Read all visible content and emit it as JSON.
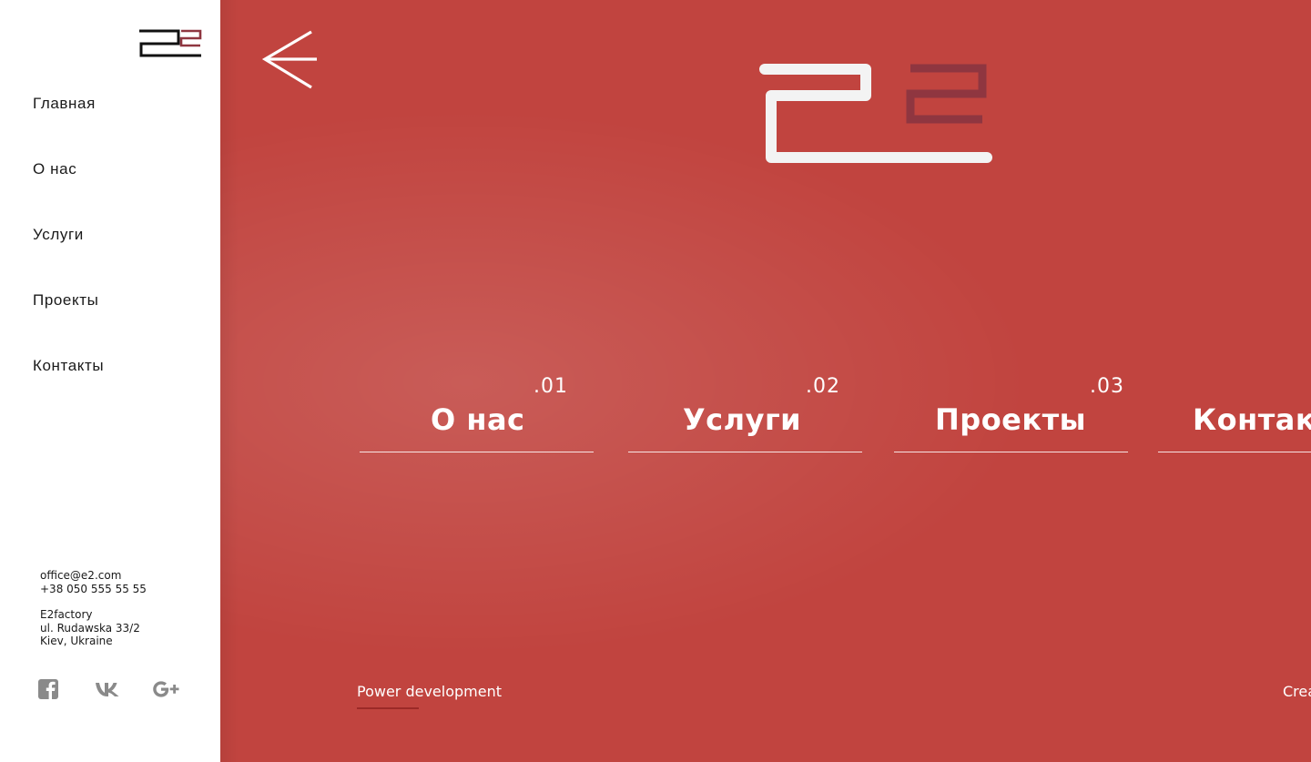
{
  "sidebar": {
    "logo_icon": "e2-logo-icon",
    "nav": [
      {
        "label": "Главная"
      },
      {
        "label": "О нас"
      },
      {
        "label": "Услуги"
      },
      {
        "label": "Проекты"
      },
      {
        "label": "Контакты"
      }
    ],
    "contact": {
      "email": "office@e2.com",
      "phone": "+38 050 555 55 55",
      "company": "E2factory",
      "street": "ul. Rudawska 33/2",
      "city": "Kiev, Ukraine"
    },
    "socials": [
      {
        "icon": "facebook-icon"
      },
      {
        "icon": "vk-icon"
      },
      {
        "icon": "google-plus-icon"
      }
    ]
  },
  "main": {
    "back_icon": "arrow-left-icon",
    "logo_icon": "e2-logo-icon",
    "sections": [
      {
        "num": ".01",
        "title": "О нас"
      },
      {
        "num": ".02",
        "title": "Услуги"
      },
      {
        "num": ".03",
        "title": "Проекты"
      },
      {
        "num": "",
        "title": "Контакты"
      }
    ],
    "footer": {
      "left": "Power development",
      "right": "Creative"
    }
  },
  "colors": {
    "accent_red": "#c1443f",
    "logo_dark_red": "#8f3640",
    "text_dark": "#1a1a1a",
    "white": "#ffffff"
  }
}
